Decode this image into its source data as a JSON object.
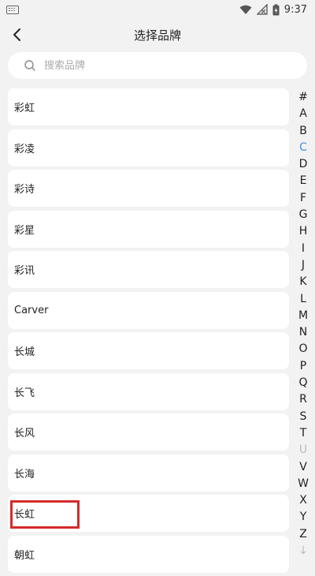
{
  "status_bar": {
    "time": "9:37"
  },
  "header": {
    "title": "选择品牌"
  },
  "search": {
    "placeholder": "搜索品牌"
  },
  "brands": [
    "彩虹",
    "彩凌",
    "彩诗",
    "彩星",
    "彩讯",
    "Carver",
    "长城",
    "长飞",
    "长风",
    "长海",
    "长虹",
    "朝虹"
  ],
  "index_letters": [
    "#",
    "A",
    "B",
    "C",
    "D",
    "E",
    "F",
    "G",
    "H",
    "I",
    "J",
    "K",
    "L",
    "M",
    "N",
    "O",
    "P",
    "Q",
    "R",
    "S",
    "T",
    "U",
    "V",
    "W",
    "X",
    "Y",
    "Z",
    "↓"
  ],
  "active_letter": "C",
  "dim_letter": "U",
  "colors": {
    "accent": "#3d8fea",
    "highlight": "#d42a2a",
    "background": "#f2f2f2"
  }
}
